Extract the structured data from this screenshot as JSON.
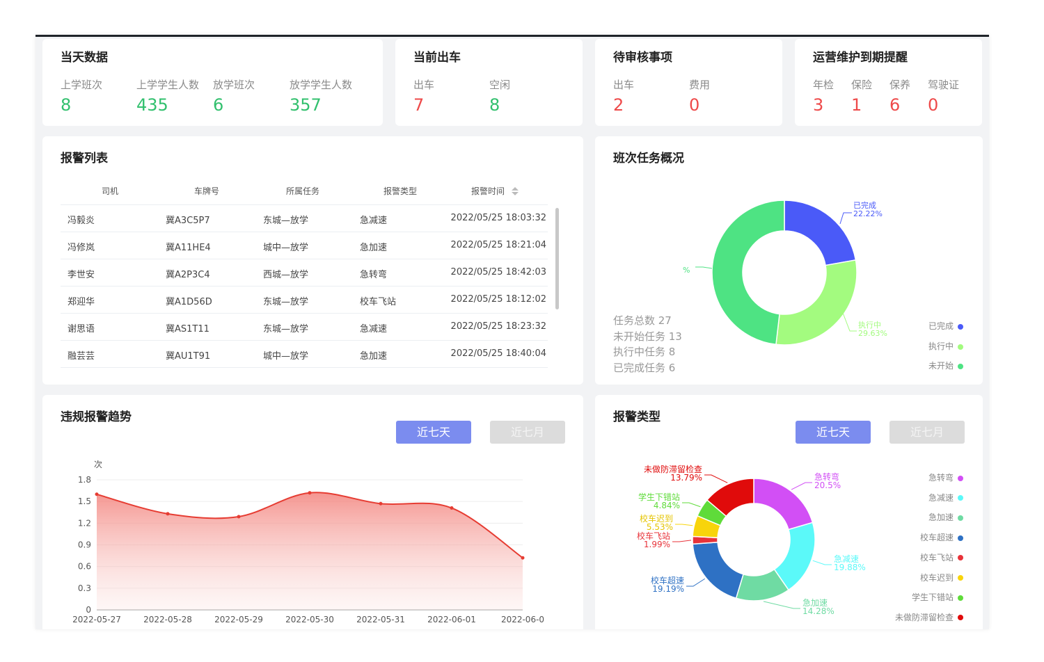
{
  "cards": {
    "today": {
      "title": "当天数据",
      "stats": [
        {
          "label": "上学班次",
          "value": "8"
        },
        {
          "label": "上学学生人数",
          "value": "435"
        },
        {
          "label": "放学班次",
          "value": "6"
        },
        {
          "label": "放学学生人数",
          "value": "357"
        }
      ]
    },
    "current": {
      "title": "当前出车",
      "stats": [
        {
          "label": "出车",
          "value": "7"
        },
        {
          "label": "空闲",
          "value": "8"
        }
      ]
    },
    "pending": {
      "title": "待审核事项",
      "stats": [
        {
          "label": "出车",
          "value": "2"
        },
        {
          "label": "费用",
          "value": "0"
        }
      ]
    },
    "maintenance": {
      "title": "运营维护到期提醒",
      "stats": [
        {
          "label": "年检",
          "value": "3"
        },
        {
          "label": "保险",
          "value": "1"
        },
        {
          "label": "保养",
          "value": "6"
        },
        {
          "label": "驾驶证",
          "value": "0"
        }
      ]
    }
  },
  "alarm_list": {
    "title": "报警列表",
    "columns": [
      "司机",
      "车牌号",
      "所属任务",
      "报警类型",
      "报警时间"
    ],
    "rows": [
      [
        "冯毅炎",
        "冀A3C5P7",
        "东城—放学",
        "急减速",
        "2022/05/25 18:03:32"
      ],
      [
        "冯修岚",
        "冀A11HE4",
        "城中—放学",
        "急加速",
        "2022/05/25 18:21:04"
      ],
      [
        "李世安",
        "冀A2P3C4",
        "西城—放学",
        "急转弯",
        "2022/05/25 18:42:03"
      ],
      [
        "郑迎华",
        "冀A1D56D",
        "东城—放学",
        "校车飞站",
        "2022/05/25 18:12:02"
      ],
      [
        "谢思语",
        "冀AS1T11",
        "东城—放学",
        "急减速",
        "2022/05/25 18:23:32"
      ],
      [
        "融芸芸",
        "冀AU1T91",
        "城中—放学",
        "急加速",
        "2022/05/25 18:40:04"
      ]
    ]
  },
  "task_overview": {
    "title": "班次任务概况",
    "summary": [
      "任务总数 27",
      "未开始任务 13",
      "执行中任务 8",
      "已完成任务 6"
    ],
    "legend": [
      "已完成",
      "执行中",
      "未开始"
    ],
    "slice_labels": [
      {
        "name": "已完成",
        "pct": "22.22%"
      },
      {
        "name": "执行中",
        "pct": "29.63%"
      },
      {
        "name": "",
        "pct": "%"
      }
    ]
  },
  "trend": {
    "title": "违规报警趋势",
    "btn_week": "近七天",
    "btn_month": "近七月",
    "unit": "次"
  },
  "alarm_type": {
    "title": "报警类型",
    "btn_week": "近七天",
    "btn_month": "近七月",
    "labels": [
      {
        "name": "急转弯",
        "pct": "20.5%"
      },
      {
        "name": "急减速",
        "pct": "19.88%"
      },
      {
        "name": "急加速",
        "pct": "14.28%"
      },
      {
        "name": "校车超速",
        "pct": "19.19%"
      },
      {
        "name": "校车飞站",
        "pct": "1.99%"
      },
      {
        "name": "校车迟到",
        "pct": "5.53%"
      },
      {
        "name": "学生下错站",
        "pct": "4.84%"
      },
      {
        "name": "未做防滞留检查",
        "pct": "13.79%"
      }
    ]
  },
  "colors": {
    "completed": "#4a5af8",
    "in_progress": "#a3fb7f",
    "not_started": "#4ee383",
    "trend_line": "#e63c32"
  },
  "chart_data": [
    {
      "type": "pie",
      "labels": [
        "已完成",
        "执行中",
        "未开始"
      ],
      "values": [
        22.22,
        29.63,
        48.15
      ],
      "colors": [
        "#4a5af8",
        "#a3fb7f",
        "#4ee383"
      ],
      "legend": "bottom-right"
    },
    {
      "type": "area",
      "x": [
        "2022-05-27",
        "2022-05-28",
        "2022-05-29",
        "2022-05-30",
        "2022-05-31",
        "2022-06-01",
        "2022-06-0"
      ],
      "series": [
        {
          "values": [
            1.6,
            1.33,
            1.29,
            1.62,
            1.47,
            1.41,
            0.72
          ]
        }
      ],
      "ylabel": "次",
      "ylim": [
        0,
        1.8
      ],
      "yticks": [
        "0",
        "0.3",
        "0.6",
        "0.9",
        "1.2",
        "1.5",
        "1.8"
      ],
      "grid": true
    },
    {
      "type": "pie",
      "labels": [
        "急转弯",
        "急减速",
        "急加速",
        "校车超速",
        "校车飞站",
        "校车迟到",
        "学生下错站",
        "未做防滞留检查"
      ],
      "values": [
        20.5,
        19.88,
        14.28,
        19.19,
        1.99,
        5.53,
        4.84,
        13.79
      ],
      "colors": [
        "#d24ff5",
        "#5bf9f9",
        "#6fdba3",
        "#2e71c4",
        "#e8333a",
        "#f8d40b",
        "#5fdb3a",
        "#e00b0b"
      ],
      "legend": "right"
    }
  ]
}
